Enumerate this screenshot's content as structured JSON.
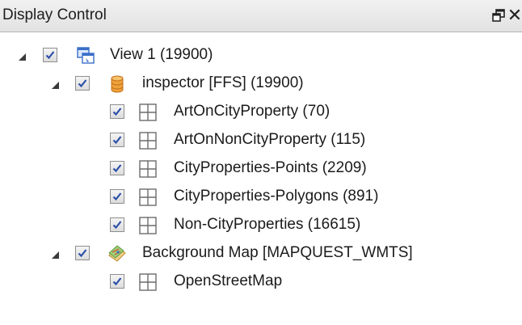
{
  "panel": {
    "title": "Display Control",
    "float_button_icon": "float-window-icon",
    "close_button_icon": "close-icon"
  },
  "tree": {
    "view": {
      "label": "View 1 (19900)",
      "icon": "view-windows-icon",
      "expanded": true,
      "checked": true
    },
    "inspector": {
      "label": "inspector [FFS] (19900)",
      "icon": "database-icon",
      "expanded": true,
      "checked": true,
      "children": [
        {
          "label": "ArtOnCityProperty (70)",
          "icon": "grid-layer-icon",
          "checked": true
        },
        {
          "label": "ArtOnNonCityProperty (115)",
          "icon": "grid-layer-icon",
          "checked": true
        },
        {
          "label": "CityProperties-Points (2209)",
          "icon": "grid-layer-icon",
          "checked": true
        },
        {
          "label": "CityProperties-Polygons (891)",
          "icon": "grid-layer-icon",
          "checked": true
        },
        {
          "label": "Non-CityProperties (16615)",
          "icon": "grid-layer-icon",
          "checked": true
        }
      ]
    },
    "background": {
      "label": "Background Map [MAPQUEST_WMTS]",
      "icon": "map-icon",
      "expanded": true,
      "checked": true,
      "children": [
        {
          "label": "OpenStreetMap",
          "icon": "grid-layer-icon",
          "checked": true
        }
      ]
    }
  },
  "colors": {
    "checkmark": "#2b4fa8",
    "view_icon": "#3b6fc8",
    "database_icon": "#e08a1e",
    "grid_icon": "#6b6b6b"
  }
}
